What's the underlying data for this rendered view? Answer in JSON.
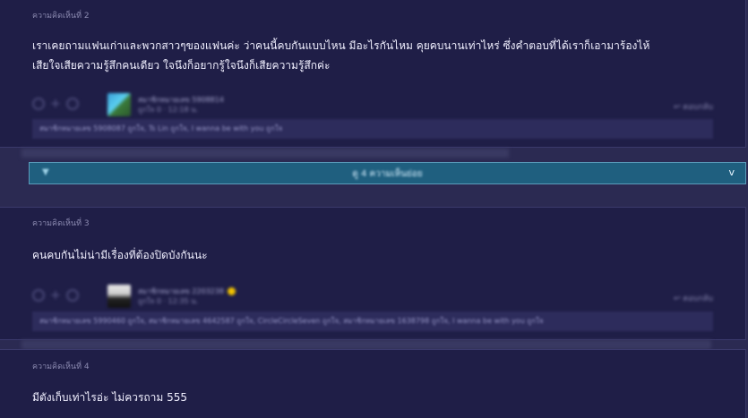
{
  "comments": [
    {
      "header": "ความคิดเห็นที่ 2",
      "text_line1": "เราเคยถามแฟนเก่าและพวกสาวๆของแฟนค่ะ ว่าคนนี้คบกันแบบไหน มีอะไรกันไหม คุยคบนานเท่าไหร่ ซึ่งคำตอบที่ได้เราก็เอามาร้องไห้",
      "text_line2": "เสียใจเสียความรู้สึกคนเดียว ใจนึงก็อยากรู้ใจนึงก็เสียความรู้สึกค่ะ",
      "username": "สมาชิกหมายเลข 5908814",
      "time": "ถูกใจ 0 · 12:18 น.",
      "reply": "ตอบกลับ",
      "quote": "สมาชิกหมายเลข 5908087 ถูกใจ, Ts Lin ถูกใจ, I wanna be with you ถูกใจ"
    },
    {
      "header": "ความคิดเห็นที่ 3",
      "text": "คนคบกันไม่น่ามีเรื่องที่ต้องปิดบังกันนะ",
      "username": "สมาชิกหมายเลข 2203238",
      "time": "ถูกใจ 0 · 12:35 น.",
      "reply": "ตอบกลับ",
      "quote": "สมาชิกหมายเลข 5990460 ถูกใจ, สมาชิกหมายเลข 4642587 ถูกใจ, CircleCircleSeven ถูกใจ, สมาชิกหมายเลข 1638798 ถูกใจ, I wanna be with you ถูกใจ"
    },
    {
      "header": "ความคิดเห็นที่ 4",
      "text": "มีตังเก็บเท่าไรอ่ะ ไม่ควรถาม 555"
    }
  ],
  "more_bar": {
    "label": "ดู 4 ความเห็นย่อย",
    "chevron_left": "▼",
    "chevron_right": "v"
  },
  "colors": {
    "background": "#2b2a52",
    "comment_bg": "#1f1e47",
    "more_bar": "#1f5f7f"
  }
}
